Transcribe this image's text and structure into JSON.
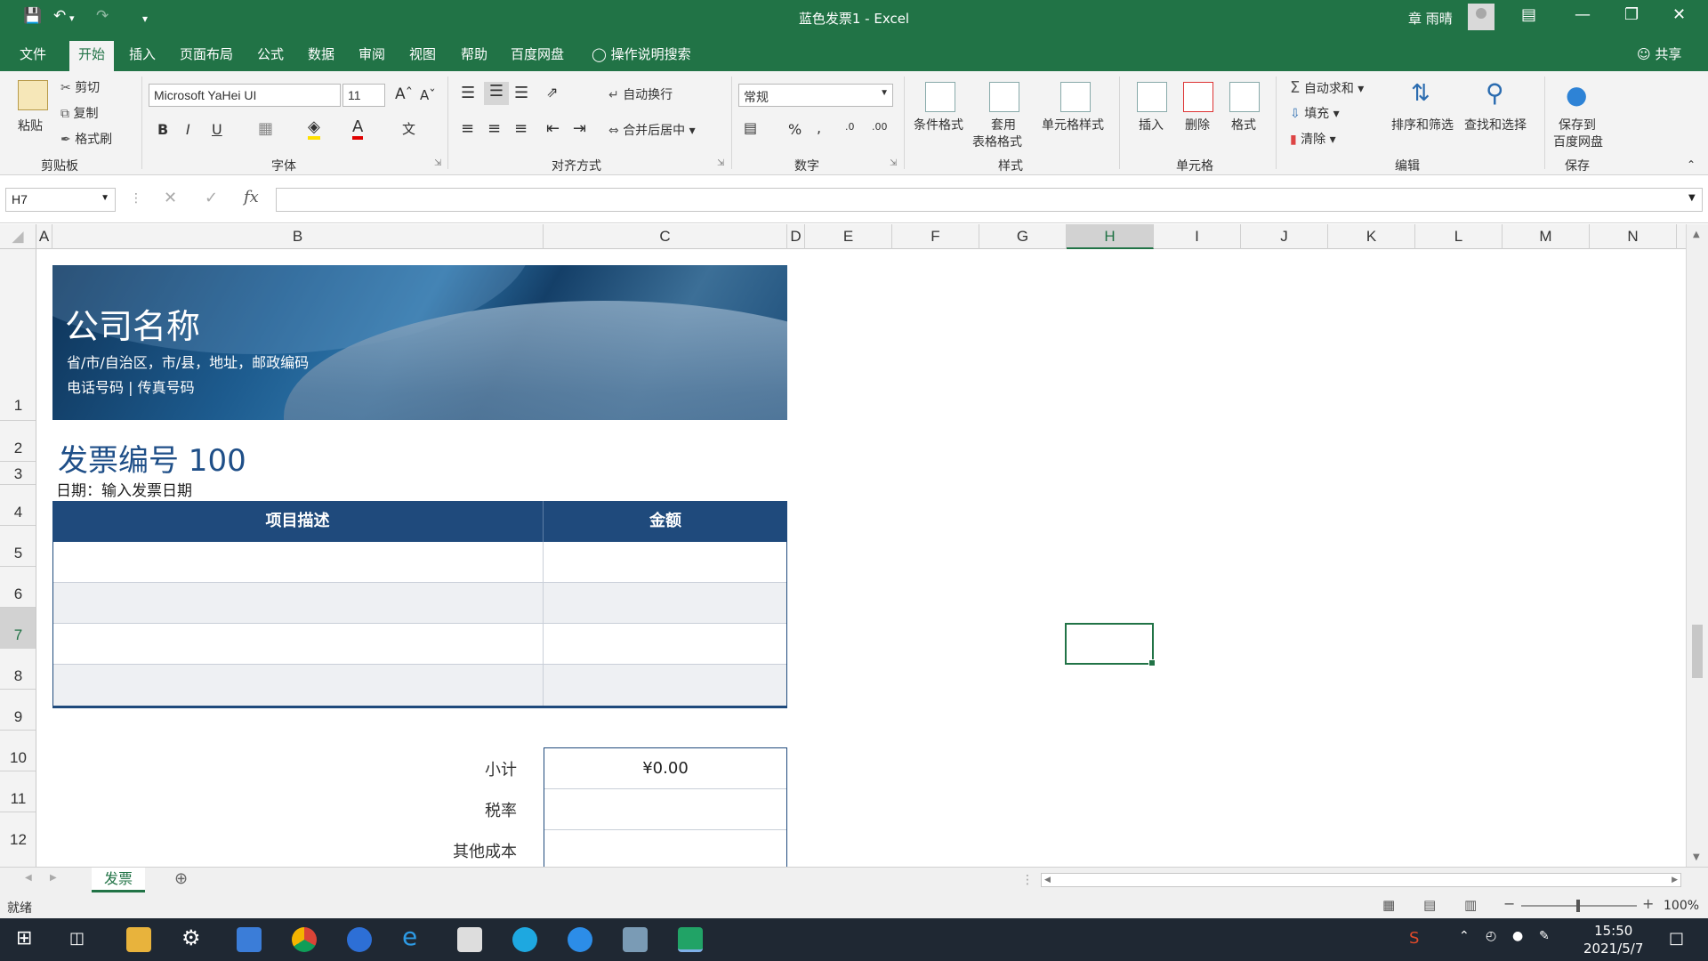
{
  "titlebar": {
    "doc_title": "蓝色发票1  -  Excel",
    "user": "章 雨晴"
  },
  "tabs": [
    "文件",
    "开始",
    "插入",
    "页面布局",
    "公式",
    "数据",
    "审阅",
    "视图",
    "帮助",
    "百度网盘"
  ],
  "active_tab": "开始",
  "tell_me": "操作说明搜索",
  "share": "共享",
  "ribbon": {
    "clipboard": {
      "paste": "粘贴",
      "cut": "剪切",
      "copy": "复制",
      "painter": "格式刷",
      "label": "剪贴板"
    },
    "font": {
      "name": "Microsoft YaHei UI",
      "size": "11",
      "label": "字体",
      "bold": "B",
      "italic": "I",
      "underline": "U"
    },
    "align": {
      "wrap": "自动换行",
      "merge": "合并后居中",
      "label": "对齐方式"
    },
    "number": {
      "format": "常规",
      "label": "数字"
    },
    "styles": {
      "cond": "条件格式",
      "table1": "套用",
      "table2": "表格格式",
      "cell": "单元格样式",
      "label": "样式"
    },
    "cells": {
      "insert": "插入",
      "delete": "删除",
      "format": "格式",
      "label": "单元格"
    },
    "editing": {
      "autosum": "自动求和",
      "fill": "填充",
      "clear": "清除",
      "sort": "排序和筛选",
      "find": "查找和选择",
      "label": "编辑"
    },
    "save": {
      "line1": "保存到",
      "line2": "百度网盘",
      "label": "保存"
    }
  },
  "namebox": "H7",
  "columns": [
    "A",
    "B",
    "C",
    "D",
    "E",
    "F",
    "G",
    "H",
    "I",
    "J",
    "K",
    "L",
    "M",
    "N"
  ],
  "selected_column": "H",
  "rows": [
    "1",
    "2",
    "3",
    "4",
    "5",
    "6",
    "7",
    "8",
    "9",
    "10",
    "11",
    "12"
  ],
  "selected_row": "7",
  "invoice": {
    "company": "公司名称",
    "address": "省/市/自治区，市/县，地址，邮政编码",
    "phone": "电话号码 | 传真号码",
    "number": "发票编号 100",
    "date": "日期：输入发票日期",
    "header": {
      "desc": "项目描述",
      "amount": "金额"
    },
    "subtotal_label": "小计",
    "subtotal_value": "¥0.00",
    "tax_label": "税率",
    "other_label": "其他成本"
  },
  "sheet_tab": "发票",
  "status": {
    "ready": "就绪",
    "zoom": "100%"
  },
  "taskbar": {
    "time": "15:50",
    "date": "2021/5/7"
  }
}
